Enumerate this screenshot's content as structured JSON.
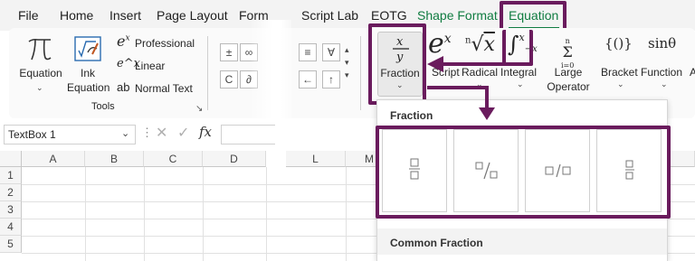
{
  "menu": {
    "items": [
      "File",
      "Home",
      "Insert",
      "Page Layout",
      "Form",
      "Script Lab",
      "EOTG",
      "Shape Format",
      "Equation"
    ],
    "active": "Equation"
  },
  "tools_group": {
    "equation_label": "Equation",
    "ink_label_1": "Ink",
    "ink_label_2": "Equation",
    "professional_label": "Professional",
    "linear_label": "Linear",
    "normal_text_label": "Normal Text",
    "group_label": "Tools"
  },
  "symbols": {
    "row1": [
      "±",
      "∞"
    ],
    "row2": [
      "C",
      "∂"
    ],
    "row1b": [
      "≡",
      "∀"
    ],
    "row2b": [
      "←",
      "↑"
    ]
  },
  "structures": {
    "fraction": "Fraction",
    "script": "Script",
    "radical": "Radical",
    "integral": "Integral",
    "large_operator_1": "Large",
    "large_operator_2": "Operator",
    "bracket": "Bracket",
    "function": "Function",
    "next_cut": "A"
  },
  "formula_bar": {
    "name_box": "TextBox 1",
    "fx": "fx"
  },
  "grid": {
    "columns": [
      "A",
      "B",
      "C",
      "D",
      "L",
      "M"
    ],
    "rows": [
      "1",
      "2",
      "3",
      "4",
      "5"
    ]
  },
  "dropdown": {
    "title": "Fraction",
    "section2": "Common Fraction",
    "tiles": [
      "Stacked Fraction",
      "Skewed Fraction",
      "Linear Fraction",
      "Small Fraction"
    ]
  },
  "accent_color": "#6a1b5d",
  "tab_color": "#107c41"
}
